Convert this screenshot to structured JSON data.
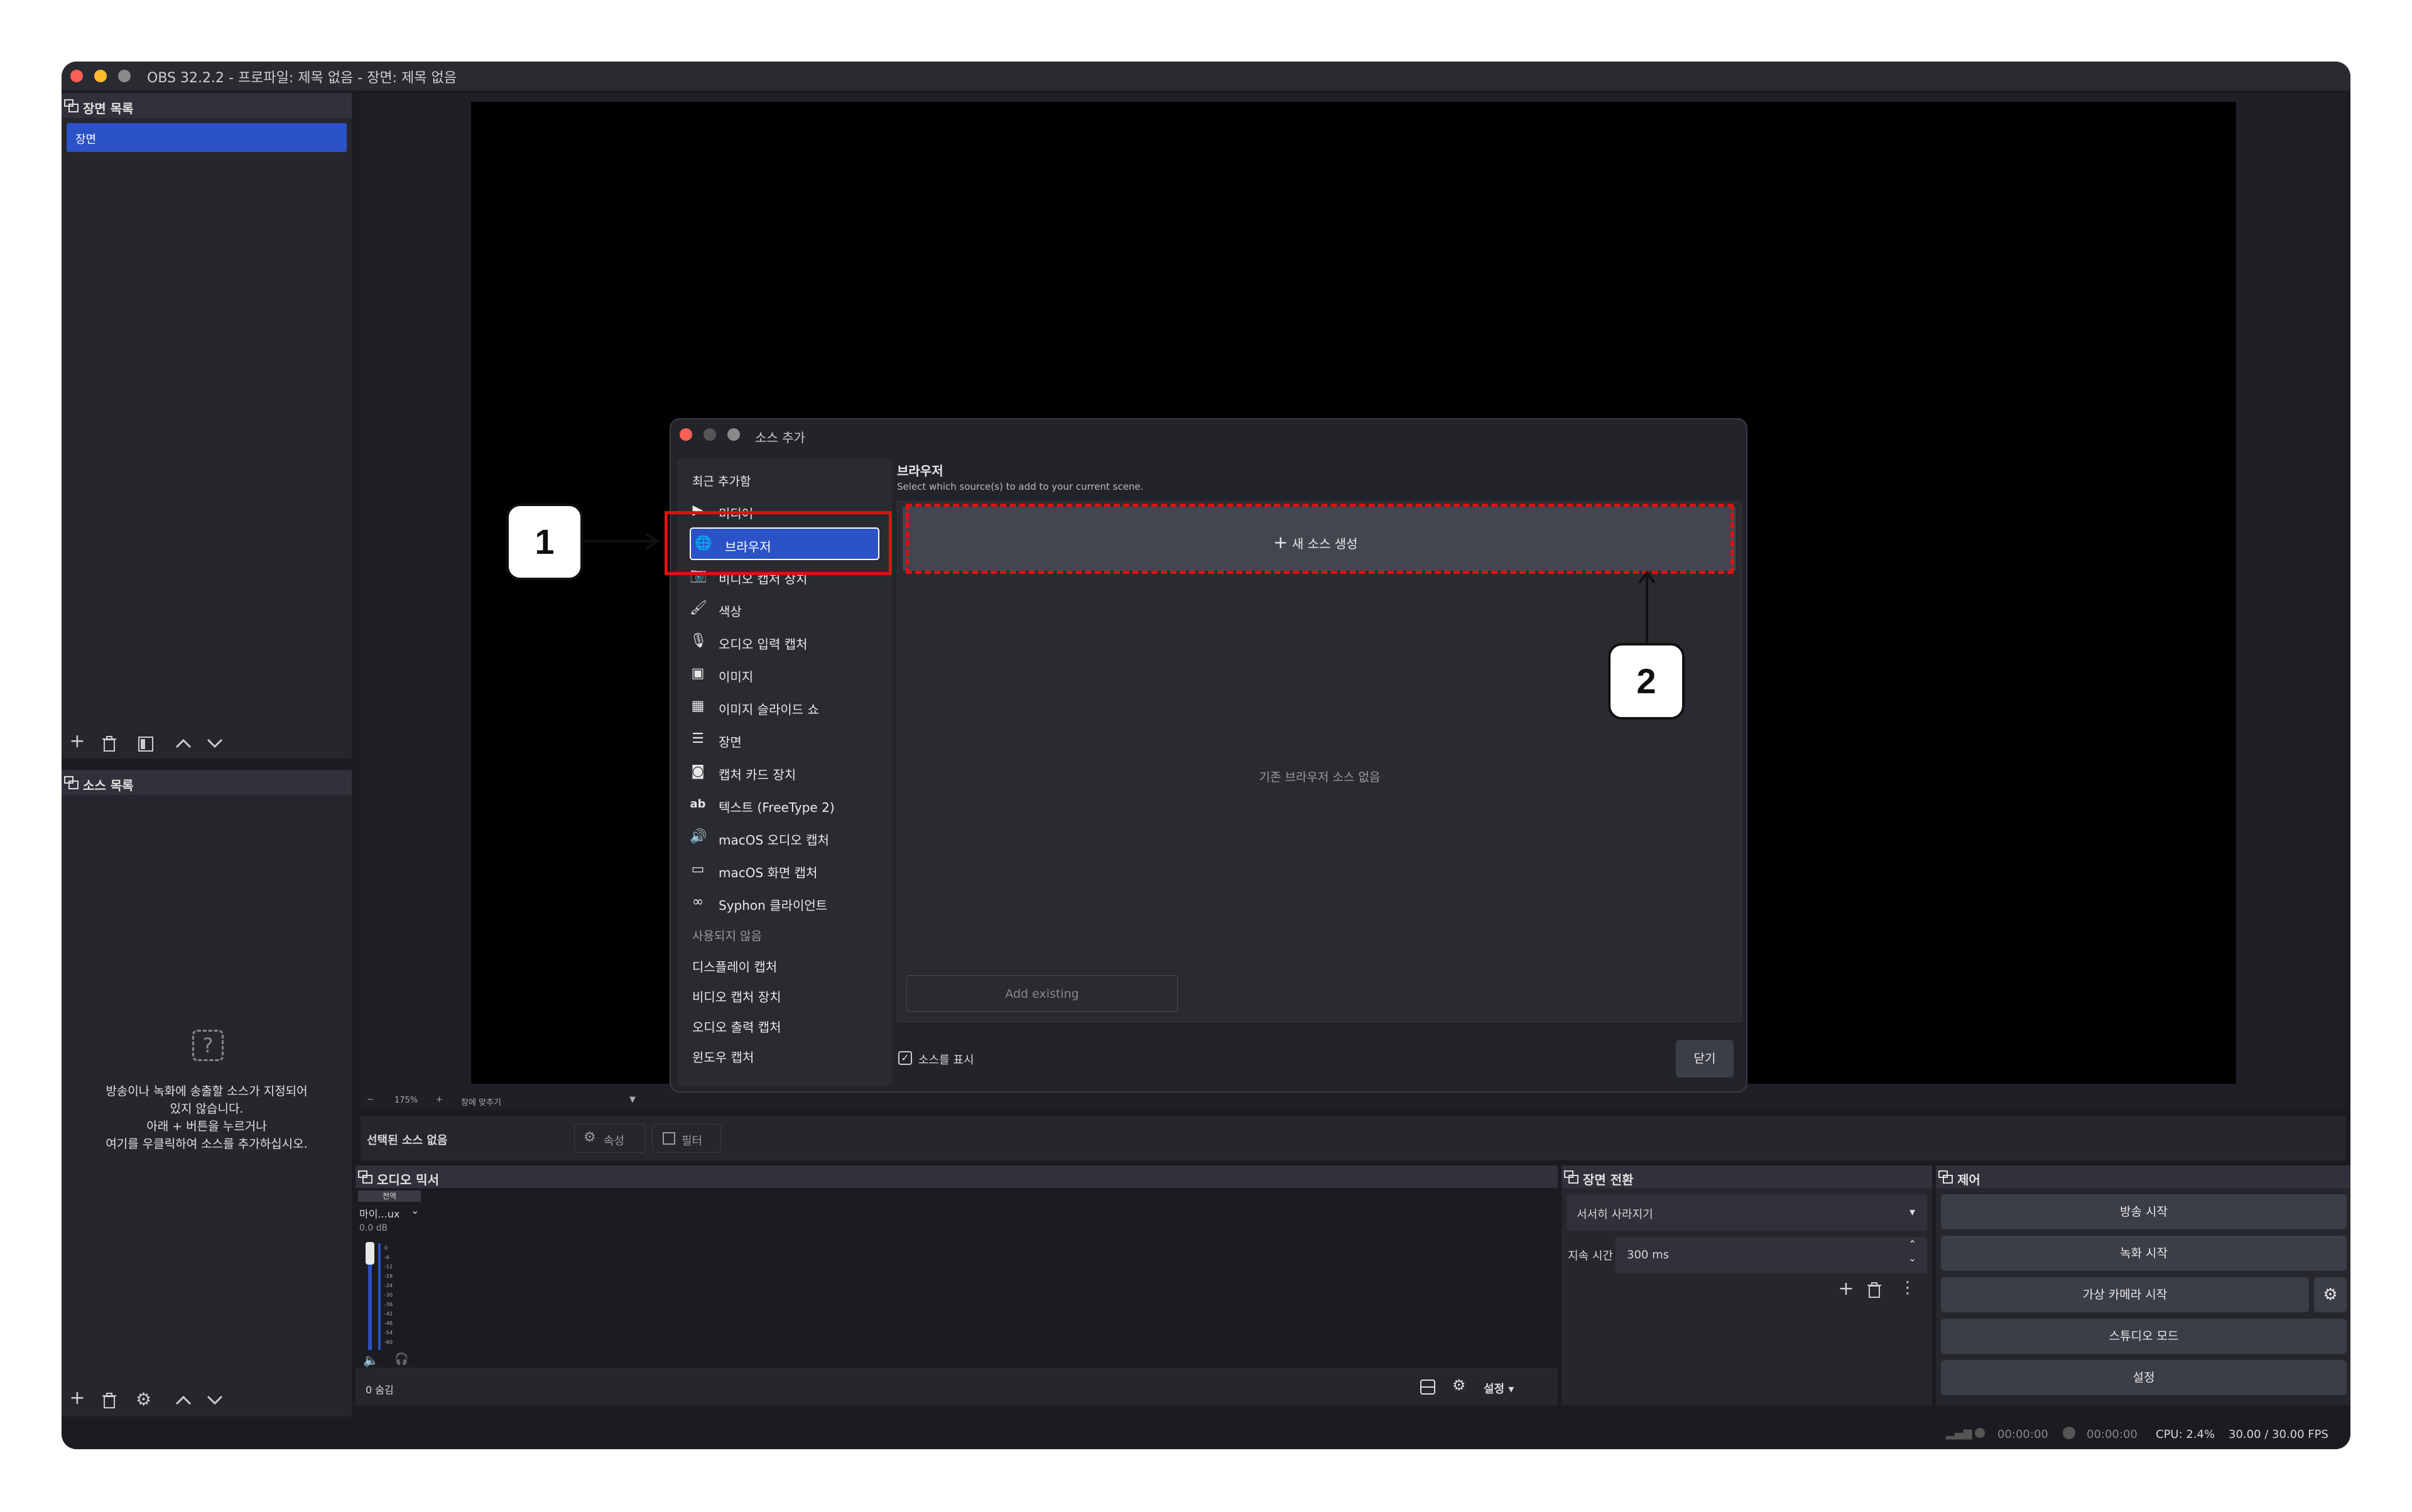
{
  "app": {
    "title": "OBS 32.2.2 - 프로파일: 제목 없음 - 장면: 제목 없음"
  },
  "scenes": {
    "title": "장면 목록",
    "items": [
      "장면"
    ]
  },
  "sources": {
    "title": "소스 목록",
    "empty_lines": [
      "방송이나 녹화에 송출할 소스가 지정되어",
      "있지 않습니다.",
      "아래 + 버튼을 누르거나",
      "여기를 우클릭하여 소스를 추가하십시오."
    ]
  },
  "preview_bar": {
    "zoom": "175%",
    "fit_label": "창에 맞추기"
  },
  "context_bar": {
    "no_source": "선택된 소스 없음",
    "properties": "속성",
    "filters": "필터"
  },
  "mixer": {
    "title": "오디오 믹서",
    "channel_tag": "전역",
    "channel_name": "마이...ux",
    "db": "0.0 dB",
    "scale": [
      "0",
      "-6",
      "-12",
      "-18",
      "-24",
      "-30",
      "-36",
      "-42",
      "-48",
      "-54",
      "-60"
    ],
    "hidden_count": "0 숨김",
    "settings": "설정"
  },
  "transitions": {
    "title": "장면 전환",
    "selected": "서서히 사라지기",
    "duration_label": "지속 시간",
    "duration_value": "300 ms"
  },
  "controls": {
    "title": "제어",
    "buttons": [
      "방송 시작",
      "녹화 시작",
      "가상 카메라 시작",
      "스튜디오 모드",
      "설정"
    ]
  },
  "status": {
    "stream_time": "00:00:00",
    "rec_time": "00:00:00",
    "cpu": "CPU: 2.4%",
    "fps": "30.00 / 30.00 FPS"
  },
  "dialog": {
    "title": "소스 추가",
    "recent_label": "최근 추가함",
    "recent_items": [
      {
        "icon": "play-icon",
        "label": "미디어"
      },
      {
        "icon": "globe-icon",
        "label": "브라우저"
      },
      {
        "icon": "camera-icon",
        "label": "비디오 캡처 장치"
      }
    ],
    "all_items": [
      {
        "icon": "paintbrush-icon",
        "label": "색상"
      },
      {
        "icon": "microphone-icon",
        "label": "오디오 입력 캡처"
      },
      {
        "icon": "image-icon",
        "label": "이미지"
      },
      {
        "icon": "slideshow-icon",
        "label": "이미지 슬라이드 쇼"
      },
      {
        "icon": "list-icon",
        "label": "장면"
      },
      {
        "icon": "capture-card-icon",
        "label": "캡처 카드 장치"
      },
      {
        "icon": "text-icon",
        "label": "텍스트 (FreeType 2)"
      },
      {
        "icon": "speaker-icon",
        "label": "macOS 오디오 캡처"
      },
      {
        "icon": "monitor-icon",
        "label": "macOS 화면 캡처"
      },
      {
        "icon": "glasses-icon",
        "label": "Syphon 클라이언트"
      }
    ],
    "deprecated_label": "사용되지 않음",
    "deprecated_items": [
      "디스플레이 캡처",
      "비디오 캡처 장치",
      "오디오 출력 캡처",
      "윈도우 캡처"
    ],
    "section_title": "브라우저",
    "subtitle": "Select which source(s) to add to your current scene.",
    "create_new": "새 소스 생성",
    "empty": "기존 브라우저 소스 없음",
    "add_existing": "Add existing",
    "show_sources": "소스를 표시",
    "close": "닫기"
  },
  "callouts": {
    "one": "1",
    "two": "2"
  },
  "colors": {
    "accent": "#2c52c8",
    "highlight": "#e01010"
  }
}
